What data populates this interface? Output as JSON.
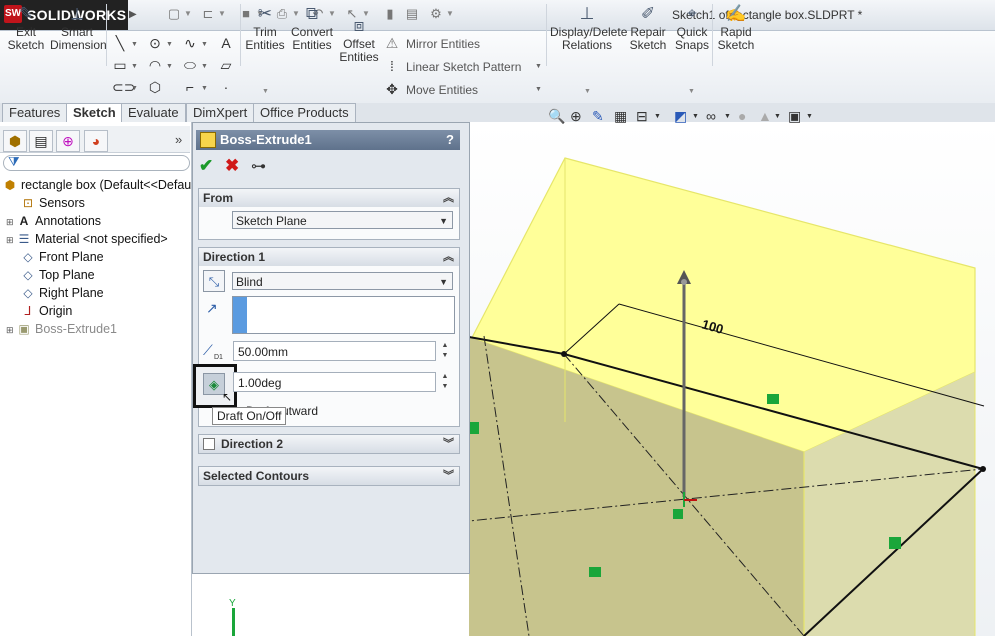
{
  "app": {
    "name": "SOLIDWORKS",
    "logo_mark": "SW",
    "document_title": "Sketch1 of rectangle box.SLDPRT *"
  },
  "commands": {
    "exit_sketch": {
      "line1": "Exit",
      "line2": "Sketch"
    },
    "smart_dimension": {
      "line1": "Smart",
      "line2": "Dimension"
    },
    "trim_entities": {
      "line1": "Trim",
      "line2": "Entities"
    },
    "convert_entities": {
      "line1": "Convert",
      "line2": "Entities"
    },
    "offset_entities": {
      "line1": "Offset",
      "line2": "Entities"
    },
    "mirror_entities": "Mirror Entities",
    "linear_sketch_pattern": "Linear Sketch Pattern",
    "move_entities": "Move Entities",
    "display_delete_relations": {
      "line1": "Display/Delete",
      "line2": "Relations"
    },
    "repair_sketch": {
      "line1": "Repair",
      "line2": "Sketch"
    },
    "quick_snaps": {
      "line1": "Quick",
      "line2": "Snaps"
    },
    "rapid_sketch": {
      "line1": "Rapid",
      "line2": "Sketch"
    }
  },
  "tabs": [
    {
      "label": "Features"
    },
    {
      "label": "Sketch"
    },
    {
      "label": "Evaluate"
    },
    {
      "label": "DimXpert"
    },
    {
      "label": "Office Products"
    }
  ],
  "tree": {
    "root": "rectangle box  (Default<<Defau",
    "items": [
      {
        "label": "Sensors"
      },
      {
        "label": "Annotations"
      },
      {
        "label": "Material <not specified>"
      },
      {
        "label": "Front Plane"
      },
      {
        "label": "Top Plane"
      },
      {
        "label": "Right Plane"
      },
      {
        "label": "Origin"
      },
      {
        "label": "Boss-Extrude1"
      }
    ]
  },
  "property_manager": {
    "title": "Boss-Extrude1",
    "help": "?",
    "from": {
      "header": "From",
      "value": "Sketch Plane"
    },
    "direction1": {
      "header": "Direction 1",
      "end_condition": "Blind",
      "depth": "50.00mm",
      "draft_angle": "1.00deg",
      "draft_outward_label": "Draft outward",
      "depth_icon_label": "D1"
    },
    "direction2": {
      "header": "Direction 2"
    },
    "selected_contours": {
      "header": "Selected Contours"
    }
  },
  "tooltip": "Draft On/Off",
  "graphics": {
    "dimension_text": "100",
    "axis_label": "Y"
  },
  "colors": {
    "box_face": "#ffff99",
    "box_edge": "#e8e860",
    "shadow": "#b9b98a",
    "relation": "#1aa63a"
  }
}
